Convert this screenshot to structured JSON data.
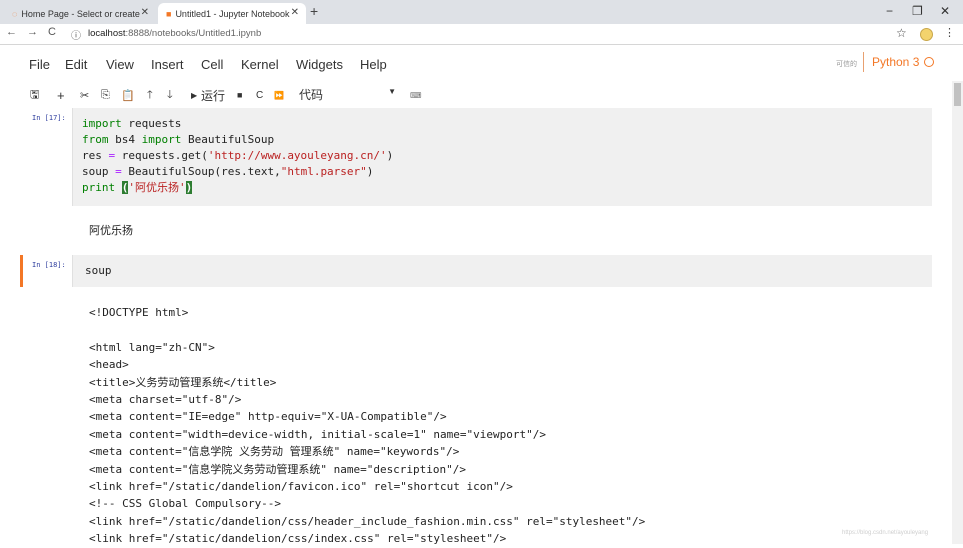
{
  "browser": {
    "tabs": [
      {
        "title": "Home Page - Select or create",
        "icon": "jupyter-tab-icon"
      },
      {
        "title": "Untitled1 - Jupyter Notebook",
        "icon": "notebook-tab-icon"
      }
    ],
    "url_host": "localhost",
    "url_path": ":8888/notebooks/Untitled1.ipynb"
  },
  "menu": {
    "items": [
      "File",
      "Edit",
      "View",
      "Insert",
      "Cell",
      "Kernel",
      "Widgets",
      "Help"
    ],
    "trusted": "可信的",
    "kernel": "Python 3"
  },
  "toolbar": {
    "run_label": "运行",
    "cell_type": "代码"
  },
  "cells": [
    {
      "prompt": "In [17]:"
    },
    {
      "prompt": "In [18]:",
      "code": "soup"
    }
  ],
  "cell1_lines": {
    "l1_kw": "import",
    "l1_rest": " requests",
    "l2_kw1": "from",
    "l2_mid": " bs4 ",
    "l2_kw2": "import",
    "l2_rest": " BeautifulSoup",
    "l3_a": "res ",
    "l3_eq": "=",
    "l3_b": " requests.get(",
    "l3_str": "'http://www.ayouleyang.cn/'",
    "l3_c": ")",
    "l4_a": "soup ",
    "l4_eq": "=",
    "l4_b": " BeautifulSoup(res.text,",
    "l4_str": "\"html.parser\"",
    "l4_c": ")",
    "l5_fn": "print",
    "l5_sp": " ",
    "l5_open": "(",
    "l5_str": "'阿优乐扬'",
    "l5_close": ")"
  },
  "cell1_output": "阿优乐扬",
  "cell2_output": [
    "<!DOCTYPE html>",
    "",
    "<html lang=\"zh-CN\">",
    "<head>",
    "<title>义务劳动管理系统</title>",
    "<meta charset=\"utf-8\"/>",
    "<meta content=\"IE=edge\" http-equiv=\"X-UA-Compatible\"/>",
    "<meta content=\"width=device-width, initial-scale=1\" name=\"viewport\"/>",
    "<meta content=\"信息学院 义务劳动 管理系统\" name=\"keywords\"/>",
    "<meta content=\"信息学院义务劳动管理系统\" name=\"description\"/>",
    "<link href=\"/static/dandelion/favicon.ico\" rel=\"shortcut icon\"/>",
    "<!-- CSS Global Compulsory-->",
    "<link href=\"/static/dandelion/css/header_include_fashion.min.css\" rel=\"stylesheet\"/>",
    "<link href=\"/static/dandelion/css/index.css\" rel=\"stylesheet\"/>"
  ],
  "watermark": "https://blog.csdn.net/ayouleyang"
}
